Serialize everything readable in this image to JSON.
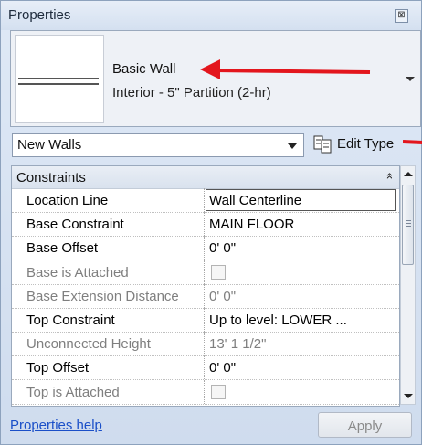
{
  "window": {
    "title": "Properties",
    "close_glyph": "⊠"
  },
  "type_selector": {
    "family": "Basic Wall",
    "type": "Interior - 5\" Partition (2-hr)",
    "thumbnail_icon": "wall-thumbnail-icon"
  },
  "instance_filter": {
    "selected": "New Walls"
  },
  "edit_type": {
    "label": "Edit Type",
    "icon": "edit-type-icon"
  },
  "grid": {
    "group": {
      "label": "Constraints",
      "collapse_glyph": "»"
    },
    "rows": [
      {
        "name": "Location Line",
        "value": "Wall Centerline",
        "enabled": true,
        "kind": "text",
        "selected": true
      },
      {
        "name": "Base Constraint",
        "value": "MAIN FLOOR",
        "enabled": true,
        "kind": "text"
      },
      {
        "name": "Base Offset",
        "value": "0'  0\"",
        "enabled": true,
        "kind": "text"
      },
      {
        "name": "Base is Attached",
        "value": "",
        "enabled": false,
        "kind": "checkbox",
        "checked": false
      },
      {
        "name": "Base Extension Distance",
        "value": "0'  0\"",
        "enabled": false,
        "kind": "text"
      },
      {
        "name": "Top Constraint",
        "value": "Up to level: LOWER ...",
        "enabled": true,
        "kind": "text"
      },
      {
        "name": "Unconnected Height",
        "value": "13'  1 1/2\"",
        "enabled": false,
        "kind": "text"
      },
      {
        "name": "Top Offset",
        "value": "0'  0\"",
        "enabled": true,
        "kind": "text"
      },
      {
        "name": "Top is Attached",
        "value": "",
        "enabled": false,
        "kind": "checkbox",
        "checked": false
      }
    ]
  },
  "footer": {
    "help_link": "Properties help",
    "apply_label": "Apply"
  },
  "colors": {
    "annotation_arrow": "#e3161d",
    "link": "#1a4fc8",
    "disabled_text": "#7f7f7f"
  }
}
